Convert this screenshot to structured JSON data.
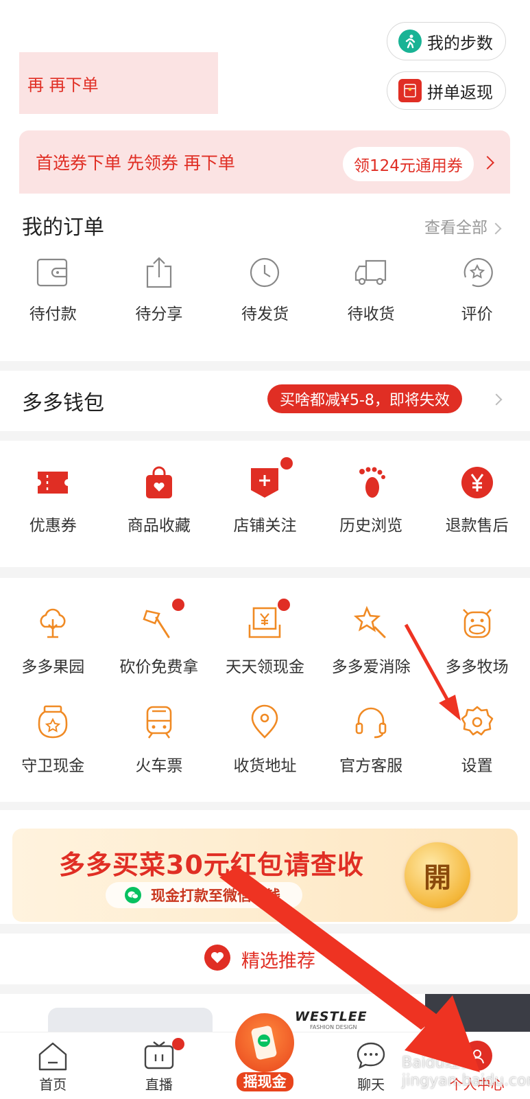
{
  "header": {
    "steps_label": "我的步数",
    "group_refund_label": "拼单返现",
    "faded_line1": "再 再下单",
    "faded_line2": "首选券下单 先领券 再下单",
    "coupon_tag": "领124元通用券"
  },
  "orders": {
    "title": "我的订单",
    "view_all": "查看全部",
    "items": [
      {
        "label": "待付款",
        "icon": "wallet-icon"
      },
      {
        "label": "待分享",
        "icon": "share-icon"
      },
      {
        "label": "待发货",
        "icon": "clock-icon"
      },
      {
        "label": "待收货",
        "icon": "truck-icon"
      },
      {
        "label": "评价",
        "icon": "review-star-icon"
      }
    ]
  },
  "wallet": {
    "title": "多多钱包",
    "promo": "买啥都减¥5-8，即将失效"
  },
  "services": {
    "items": [
      {
        "label": "优惠券",
        "icon": "coupon-icon"
      },
      {
        "label": "商品收藏",
        "icon": "favorite-bag-icon"
      },
      {
        "label": "店铺关注",
        "icon": "store-follow-icon"
      },
      {
        "label": "历史浏览",
        "icon": "footprint-icon"
      },
      {
        "label": "退款售后",
        "icon": "refund-yen-icon"
      }
    ]
  },
  "tools": {
    "row1": [
      {
        "label": "多多果园",
        "icon": "tree-icon"
      },
      {
        "label": "砍价免费拿",
        "icon": "axe-icon"
      },
      {
        "label": "天天领现金",
        "icon": "cash-envelope-icon"
      },
      {
        "label": "多多爱消除",
        "icon": "star-wand-icon"
      },
      {
        "label": "多多牧场",
        "icon": "cow-icon"
      }
    ],
    "row2": [
      {
        "label": "守卫现金",
        "icon": "jar-icon"
      },
      {
        "label": "火车票",
        "icon": "train-icon"
      },
      {
        "label": "收货地址",
        "icon": "location-pin-icon"
      },
      {
        "label": "官方客服",
        "icon": "headset-icon"
      },
      {
        "label": "设置",
        "icon": "settings-gear-icon"
      }
    ]
  },
  "banner": {
    "title": "多多买菜30元红包请查收",
    "subtitle": "现金打款至微信零钱",
    "open_button": "開"
  },
  "recommend": {
    "title": "精选推荐",
    "product_brand": "WESTLEE",
    "product_sub": "FASHION DESIGN"
  },
  "nav": {
    "items": [
      {
        "label": "首页",
        "icon": "home-icon"
      },
      {
        "label": "直播",
        "icon": "tv-live-icon"
      },
      {
        "label": "摇现金",
        "icon": "shake-cash-icon"
      },
      {
        "label": "聊天",
        "icon": "chat-bubble-icon"
      },
      {
        "label": "个人中心",
        "icon": "profile-icon"
      }
    ]
  },
  "watermark": "Baidu经验 jingyan.baidu.com",
  "colors": {
    "brand_red": "#e02e24",
    "tool_orange": "#f08a24",
    "arrow_red": "#ee3322"
  }
}
